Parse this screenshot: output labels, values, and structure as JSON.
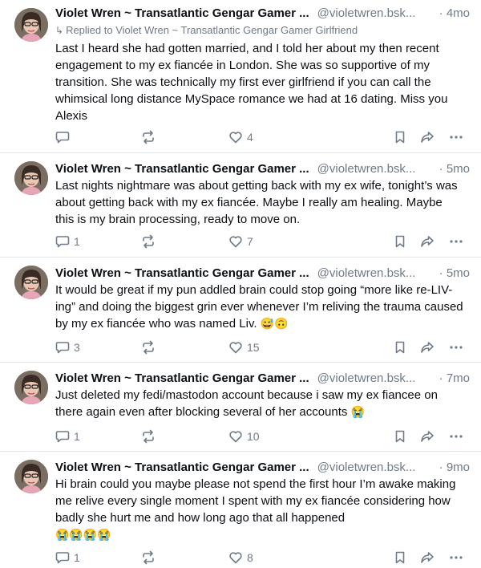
{
  "posts": [
    {
      "name": "Violet Wren ~ Transatlantic Gengar Gamer ...",
      "handle": "@violetwren.bsk...",
      "time": "· 4mo",
      "reply_to": "Replied to Violet Wren ~ Transatlantic Gengar Gamer Girlfriend",
      "text": "Last I heard she had gotten married, and I told her about my then recent engagement to my ex fiancée in London. She was so supportive of my transition. She was technically my first ever girlfriend if you can call the whimsical long distance MySpace romance we had at 16 dating. Miss you Alexis",
      "emoji": "",
      "replies": "",
      "likes": "4"
    },
    {
      "name": "Violet Wren ~ Transatlantic Gengar Gamer ...",
      "handle": "@violetwren.bsk...",
      "time": "· 5mo",
      "reply_to": "",
      "text": "Last nights nightmare was about getting back with my ex wife, tonight’s was about getting back with my ex fiancée. Maybe I really am healing. Maybe this is my brain processing, ready to move on.",
      "emoji": "",
      "replies": "1",
      "likes": "7"
    },
    {
      "name": "Violet Wren ~ Transatlantic Gengar Gamer ...",
      "handle": "@violetwren.bsk...",
      "time": "· 5mo",
      "reply_to": "",
      "text": "It would be great if my pun addled brain could stop going “more like re-LIV-ing” and doing the biggest grin ever whenever I’m reliving the trauma caused by my ex fiancée who was named Liv.",
      "emoji": "😅🙃",
      "replies": "3",
      "likes": "15"
    },
    {
      "name": "Violet Wren ~ Transatlantic Gengar Gamer ...",
      "handle": "@violetwren.bsk...",
      "time": "· 7mo",
      "reply_to": "",
      "text": "Just deleted my fedi/mastodon account because i saw my ex fiancee on there again even after blocking several of her accounts",
      "emoji": "😭",
      "replies": "1",
      "likes": "10"
    },
    {
      "name": "Violet Wren ~ Transatlantic Gengar Gamer ...",
      "handle": "@violetwren.bsk...",
      "time": "· 9mo",
      "reply_to": "",
      "text": "Hi brain could you maybe please not spend the first hour I’m awake making me relive every single moment I spent with my ex fiancée considering how badly she hurt me and how long ago that all happened",
      "emoji": "😭😭😭😭",
      "replies": "1",
      "likes": "8"
    }
  ],
  "icons": {
    "reply": "speech-bubble-icon",
    "repost": "repost-arrows-icon",
    "like": "heart-icon",
    "bookmark": "bookmark-icon",
    "share": "share-arrow-icon",
    "more": "ellipsis-icon",
    "reply_marker": "reply-arrow-icon"
  },
  "colors": {
    "muted": "#6f7b88",
    "text": "#0b0f14",
    "divider": "#e3e7eb"
  }
}
